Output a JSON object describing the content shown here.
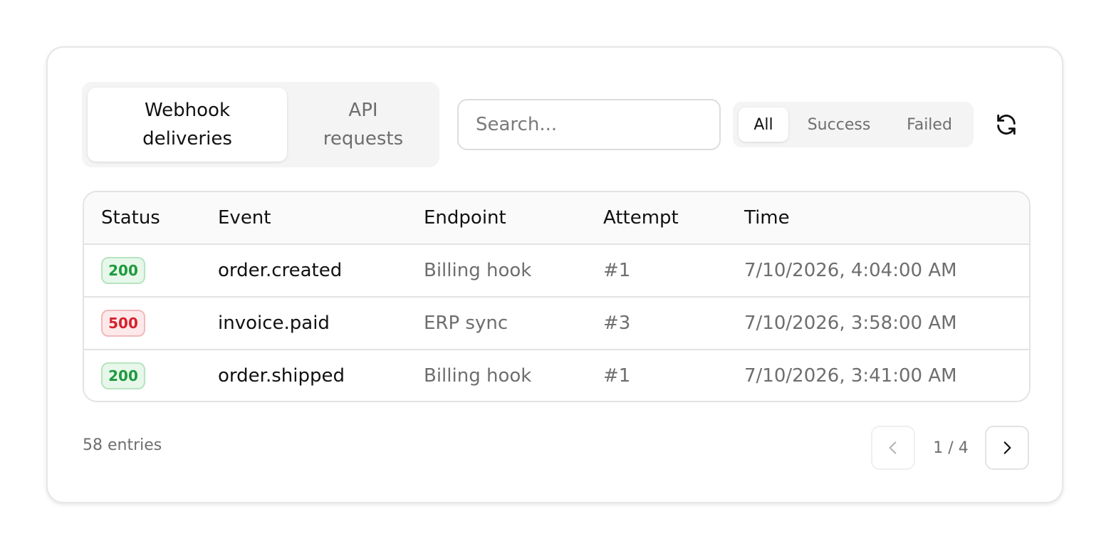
{
  "tabs": [
    {
      "label": "Webhook deliveries",
      "active": true
    },
    {
      "label": "API requests",
      "active": false
    }
  ],
  "search": {
    "placeholder": "Search...",
    "value": ""
  },
  "filters": [
    {
      "label": "All",
      "active": true
    },
    {
      "label": "Success",
      "active": false
    },
    {
      "label": "Failed",
      "active": false
    }
  ],
  "refresh_icon": "refresh-icon",
  "table": {
    "columns": [
      "Status",
      "Event",
      "Endpoint",
      "Attempt",
      "Time"
    ],
    "rows": [
      {
        "status": "200",
        "event": "order.created",
        "endpoint": "Billing hook",
        "attempt": "#1",
        "time": "7/10/2026, 4:04:00 AM"
      },
      {
        "status": "500",
        "event": "invoice.paid",
        "endpoint": "ERP sync",
        "attempt": "#3",
        "time": "7/10/2026, 3:58:00 AM"
      },
      {
        "status": "200",
        "event": "order.shipped",
        "endpoint": "Billing hook",
        "attempt": "#1",
        "time": "7/10/2026, 3:41:00 AM"
      }
    ]
  },
  "footer": {
    "entries": "58 entries",
    "page": "1 / 4",
    "prev_icon": "chevron-left-icon",
    "next_icon": "chevron-right-icon"
  },
  "colors": {
    "success_text": "#1f9a3f",
    "success_bg": "#e7f7ea",
    "error_text": "#d4232f",
    "error_bg": "#fde9ea"
  }
}
